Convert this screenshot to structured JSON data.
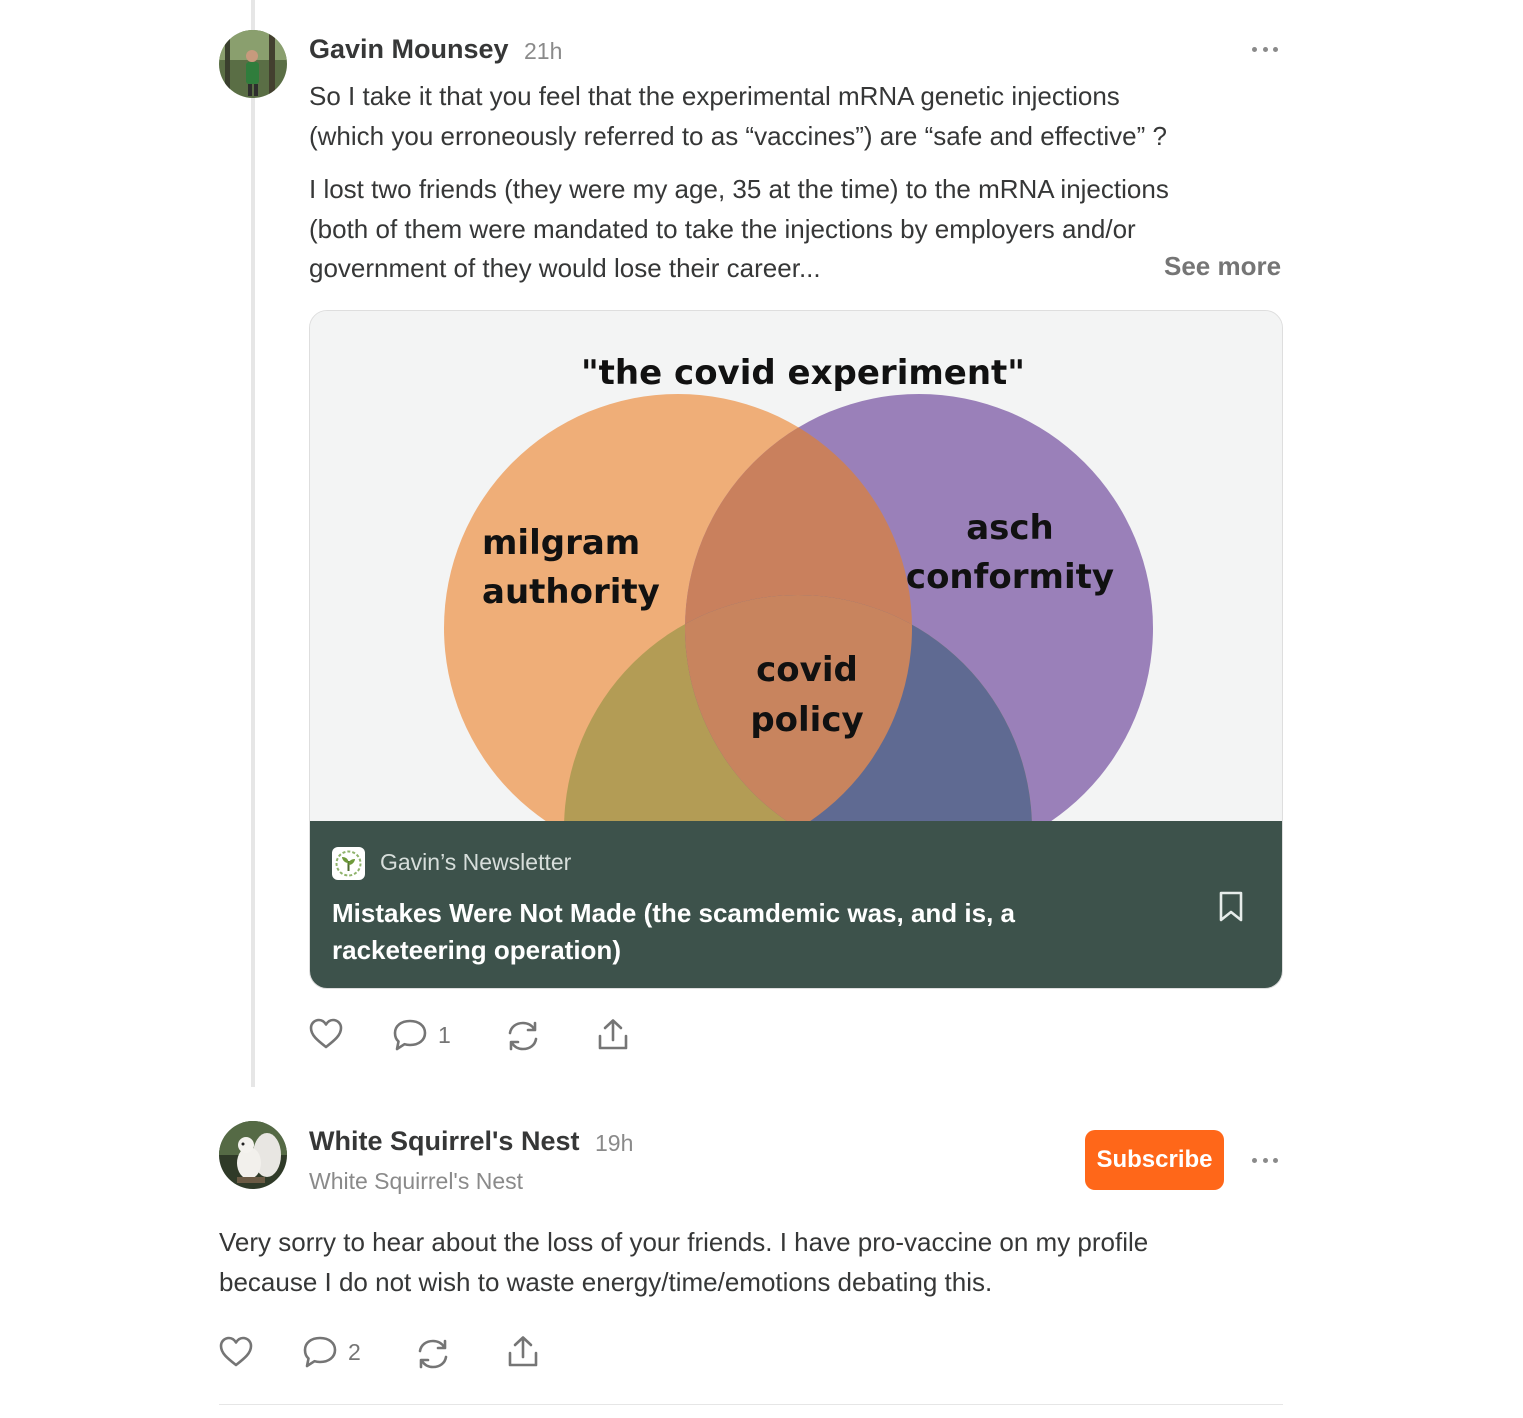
{
  "comment1": {
    "author": "Gavin Mounsey",
    "time": "21h",
    "paragraph1_line1": "So I take it that you feel that the experimental mRNA genetic injections",
    "paragraph1_line2": "(which you erroneously referred to as “vaccines”) are “safe and effective” ?",
    "paragraph2_line1": "I lost two friends (they were my age, 35 at the time) to the mRNA injections",
    "paragraph2_line2": "(both of them were mandated to take the injections by employers and/or",
    "paragraph2_line3": "government of they would lose their career...",
    "see_more": "See more",
    "attachment": {
      "image_text": {
        "title": "\"the covid experiment\"",
        "left_circle_line1": "milgram",
        "left_circle_line2": "authority",
        "right_circle_line1": "asch",
        "right_circle_line2": "conformity",
        "center_line1": "covid",
        "center_line2": "policy"
      },
      "image_colors": {
        "left": "#efae78",
        "right": "#9a80b9",
        "bottom": "#b39c55",
        "background": "#f3f4f4"
      },
      "publication": "Gavin’s Newsletter",
      "post_title": "Mistakes Were Not Made (the scamdemic was, and is, a racketeering operation)"
    },
    "actions": {
      "like_icon": "heart-icon",
      "comment_icon": "comment-bubble-icon",
      "comment_count": "1",
      "restack_icon": "restack-icon",
      "share_icon": "share-icon"
    }
  },
  "comment2": {
    "author": "White Squirrel's Nest",
    "time": "19h",
    "subtitle": "White Squirrel's Nest",
    "subscribe_label": "Subscribe",
    "body_line1": "Very sorry to hear about the loss of your friends. I have pro-vaccine on my profile",
    "body_line2": "because I do not wish to waste energy/time/emotions debating this.",
    "actions": {
      "like_icon": "heart-icon",
      "comment_icon": "comment-bubble-icon",
      "comment_count": "2",
      "restack_icon": "restack-icon",
      "share_icon": "share-icon"
    }
  },
  "colors": {
    "accent": "#ff6719",
    "card_footer": "#3d524b",
    "text": "#363737",
    "muted": "#8a8a8a"
  }
}
